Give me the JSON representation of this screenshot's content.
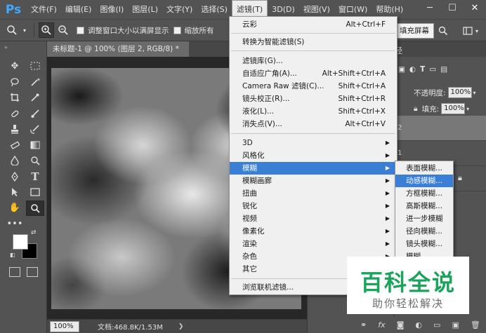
{
  "app": {
    "logo": "Ps"
  },
  "menubar": {
    "items": [
      "文件(F)",
      "编辑(E)",
      "图像(I)",
      "图层(L)",
      "文字(Y)",
      "选择(S)",
      "滤镜(T)",
      "3D(D)",
      "视图(V)",
      "窗口(W)",
      "帮助(H)"
    ],
    "active": "滤镜(T)"
  },
  "window_controls": {
    "minimize": "─",
    "maximize": "☐",
    "close": "✕"
  },
  "options": {
    "resize_windows": "调整窗口大小以满屏显示",
    "zoom_all": "缩放所有",
    "fill_screen": "填充屏幕"
  },
  "document": {
    "tab_title": "未标题-1 @ 100% (图层 2, RGB/8) *",
    "zoom": "100%",
    "doc_info": "文档:468.8K/1.53M"
  },
  "panels": {
    "tab_label": "径",
    "opacity_label": "不透明度:",
    "opacity_value": "100%",
    "fill_label": "填充:",
    "fill_value": "100%",
    "layer_1_label": "2",
    "layer_2_label": "1"
  },
  "filter_menu": {
    "items": [
      {
        "label": "云彩",
        "shortcut": "Alt+Ctrl+F"
      },
      {
        "label": "转换为智能滤镜(S)",
        "shortcut": ""
      },
      {
        "label": "滤镜库(G)...",
        "shortcut": ""
      },
      {
        "label": "自适应广角(A)...",
        "shortcut": "Alt+Shift+Ctrl+A"
      },
      {
        "label": "Camera Raw 滤镜(C)...",
        "shortcut": "Shift+Ctrl+A"
      },
      {
        "label": "镜头校正(R)...",
        "shortcut": "Shift+Ctrl+R"
      },
      {
        "label": "液化(L)...",
        "shortcut": "Shift+Ctrl+X"
      },
      {
        "label": "消失点(V)...",
        "shortcut": "Alt+Ctrl+V"
      },
      {
        "label": "3D",
        "shortcut": ""
      },
      {
        "label": "风格化",
        "shortcut": ""
      },
      {
        "label": "模糊",
        "shortcut": ""
      },
      {
        "label": "模糊画廊",
        "shortcut": ""
      },
      {
        "label": "扭曲",
        "shortcut": ""
      },
      {
        "label": "锐化",
        "shortcut": ""
      },
      {
        "label": "视频",
        "shortcut": ""
      },
      {
        "label": "像素化",
        "shortcut": ""
      },
      {
        "label": "渲染",
        "shortcut": ""
      },
      {
        "label": "杂色",
        "shortcut": ""
      },
      {
        "label": "其它",
        "shortcut": ""
      },
      {
        "label": "浏览联机滤镜...",
        "shortcut": ""
      }
    ],
    "highlighted": "模糊"
  },
  "blur_submenu": {
    "items": [
      "表面模糊...",
      "动感模糊...",
      "方框模糊...",
      "高斯模糊...",
      "进一步模糊",
      "径向模糊...",
      "镜头模糊...",
      "模糊"
    ],
    "highlighted": "动感模糊..."
  },
  "watermark": {
    "title": "百科全说",
    "subtitle": "助你轻松解决",
    "color": "#1aa35b"
  },
  "colors": {
    "ui_bg": "#535353",
    "menu_highlight": "#3a7fd6",
    "foreground": "#ffffff",
    "background": "#000000"
  }
}
